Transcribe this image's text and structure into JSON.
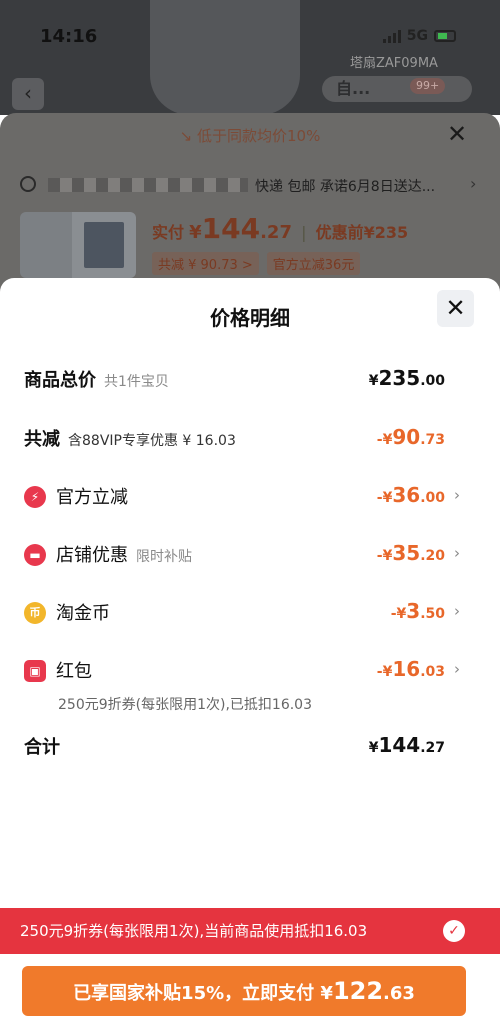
{
  "status_bar": {
    "time": "14:16",
    "network": "5G"
  },
  "background_page": {
    "model_code": "塔扇ZAF09MA",
    "nav_pill_text": "自...",
    "cart_badge": "99+",
    "deal_banner": "低于同款均价10%",
    "address_suffix": "快递 包邮 承诺6月8日送达...",
    "pay": {
      "label": "实付",
      "currency": "¥",
      "integer": "144",
      "decimal": ".27",
      "before_label": "优惠前",
      "before_value": "¥235"
    },
    "tags": [
      "共减 ¥ 90.73 >",
      "官方立减36元"
    ]
  },
  "price_detail": {
    "title": "价格明细",
    "total": {
      "label": "商品总价",
      "sub": "共1件宝贝",
      "currency": "¥",
      "integer": "235",
      "decimal": ".00"
    },
    "reduce": {
      "label": "共减",
      "sub": "含88VIP专享优惠 ¥ 16.03",
      "prefix": "-¥",
      "integer": "90",
      "decimal": ".73"
    },
    "items": [
      {
        "icon": "lightning-icon",
        "glyph": "⚡",
        "label": "官方立减",
        "sub": "",
        "prefix": "-¥",
        "integer": "36",
        "decimal": ".00"
      },
      {
        "icon": "store-icon",
        "glyph": "▬",
        "label": "店铺优惠",
        "sub": "限时补贴",
        "prefix": "-¥",
        "integer": "35",
        "decimal": ".20"
      },
      {
        "icon": "coin-icon",
        "glyph": "币",
        "label": "淘金币",
        "sub": "",
        "prefix": "-¥",
        "integer": "3",
        "decimal": ".50"
      },
      {
        "icon": "red-packet-icon",
        "glyph": "▣",
        "label": "红包",
        "sub": "",
        "prefix": "-¥",
        "integer": "16",
        "decimal": ".03"
      }
    ],
    "coupon_note": "250元9折券(每张限用1次),已抵扣16.03",
    "sum": {
      "label": "合计",
      "currency": "¥",
      "integer": "144",
      "decimal": ".27"
    }
  },
  "coupon_banner": "250元9折券(每张限用1次),当前商品使用抵扣16.03",
  "pay_button": {
    "text": "已享国家补贴15%，立即支付 ¥",
    "integer": "122",
    "decimal": ".63"
  },
  "colors": {
    "accent_orange": "#f07a2b",
    "discount_orange": "#e8672a",
    "banner_red": "#e5343f"
  }
}
